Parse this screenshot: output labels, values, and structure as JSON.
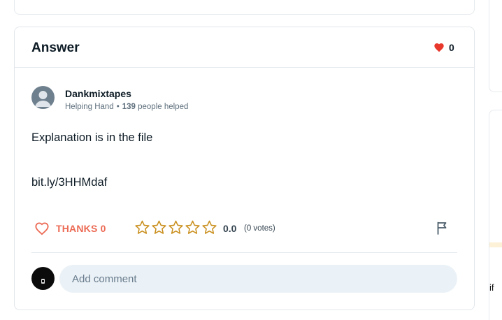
{
  "answer": {
    "title": "Answer",
    "likes_count": "0"
  },
  "author": {
    "name": "Dankmixtapes",
    "rank": "Helping Hand",
    "helped_count": "139",
    "helped_suffix": "people helped"
  },
  "content": {
    "text": "Explanation is in the file",
    "link": "bit.ly/3HHMdaf"
  },
  "actions": {
    "thanks_label": "THANKS 0",
    "rating_value": "0.0",
    "rating_votes": "(0 votes)",
    "stars": 5,
    "rating": 0
  },
  "comment": {
    "placeholder": "Add comment"
  },
  "right_panel": {
    "text_fragment": "if"
  },
  "colors": {
    "heart_red": "#e8372b",
    "thanks_accent": "#ec6a54",
    "star_gold": "#c98e1b",
    "input_bg": "#ebf2f7"
  },
  "icons": [
    "heart-icon",
    "heart-outline-icon",
    "star-outline-icon",
    "flag-icon",
    "user-avatar-icon"
  ]
}
